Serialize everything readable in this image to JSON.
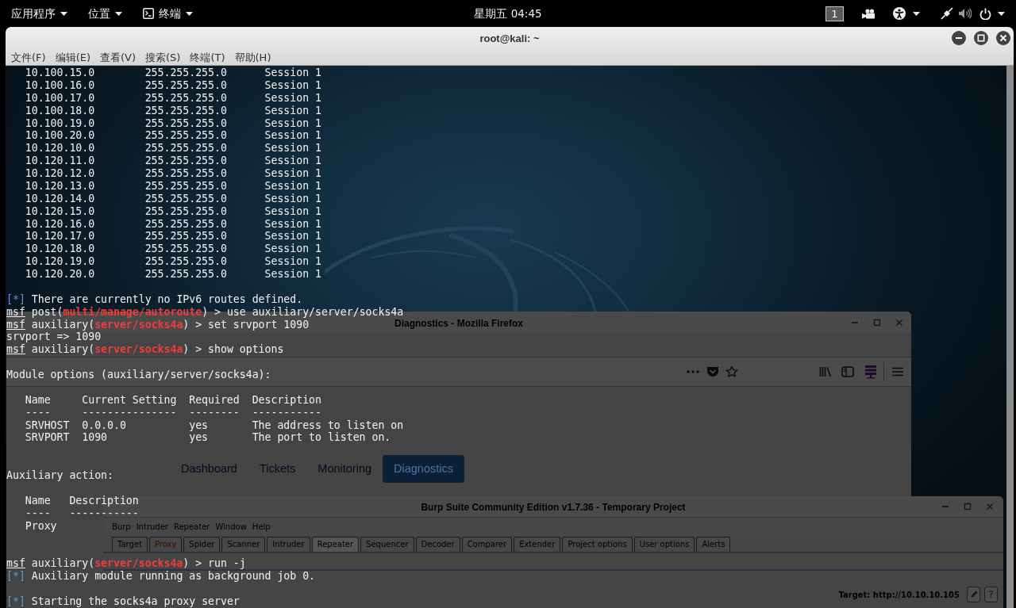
{
  "top_panel": {
    "menus": [
      {
        "label": "应用程序",
        "kind": "menu"
      },
      {
        "label": "位置",
        "kind": "menu"
      },
      {
        "label": "终端",
        "kind": "terminal"
      }
    ],
    "clock": "星期五 04:45",
    "workspace": "1"
  },
  "terminal": {
    "title": "root@kali: ~",
    "menu": [
      "文件(F)",
      "编辑(E)",
      "查看(V)",
      "搜索(S)",
      "终端(T)",
      "帮助(H)"
    ],
    "blocks": [
      {
        "kind": "route_table",
        "rows": [
          {
            "subnet": "10.100.15.0",
            "netmask": "255.255.255.0",
            "gateway": "Session 1"
          },
          {
            "subnet": "10.100.16.0",
            "netmask": "255.255.255.0",
            "gateway": "Session 1"
          },
          {
            "subnet": "10.100.17.0",
            "netmask": "255.255.255.0",
            "gateway": "Session 1"
          },
          {
            "subnet": "10.100.18.0",
            "netmask": "255.255.255.0",
            "gateway": "Session 1"
          },
          {
            "subnet": "10.100.19.0",
            "netmask": "255.255.255.0",
            "gateway": "Session 1"
          },
          {
            "subnet": "10.100.20.0",
            "netmask": "255.255.255.0",
            "gateway": "Session 1"
          },
          {
            "subnet": "10.120.10.0",
            "netmask": "255.255.255.0",
            "gateway": "Session 1"
          },
          {
            "subnet": "10.120.11.0",
            "netmask": "255.255.255.0",
            "gateway": "Session 1"
          },
          {
            "subnet": "10.120.12.0",
            "netmask": "255.255.255.0",
            "gateway": "Session 1"
          },
          {
            "subnet": "10.120.13.0",
            "netmask": "255.255.255.0",
            "gateway": "Session 1"
          },
          {
            "subnet": "10.120.14.0",
            "netmask": "255.255.255.0",
            "gateway": "Session 1"
          },
          {
            "subnet": "10.120.15.0",
            "netmask": "255.255.255.0",
            "gateway": "Session 1"
          },
          {
            "subnet": "10.120.16.0",
            "netmask": "255.255.255.0",
            "gateway": "Session 1"
          },
          {
            "subnet": "10.120.17.0",
            "netmask": "255.255.255.0",
            "gateway": "Session 1"
          },
          {
            "subnet": "10.120.18.0",
            "netmask": "255.255.255.0",
            "gateway": "Session 1"
          },
          {
            "subnet": "10.120.19.0",
            "netmask": "255.255.255.0",
            "gateway": "Session 1"
          },
          {
            "subnet": "10.120.20.0",
            "netmask": "255.255.255.0",
            "gateway": "Session 1"
          }
        ]
      },
      {
        "kind": "blank"
      },
      {
        "kind": "status",
        "segments": [
          "[*]",
          " There are currently no IPv6 routes defined."
        ]
      },
      {
        "kind": "command",
        "segments": [
          "msf",
          " post(",
          "multi/manage/autoroute",
          ") > use auxiliary/server/socks4a"
        ]
      },
      {
        "kind": "command",
        "segments": [
          "msf",
          " auxiliary(",
          "server/socks4a",
          ") > set srvport 1090"
        ]
      },
      {
        "kind": "output",
        "text": "srvport => 1090"
      },
      {
        "kind": "command",
        "segments": [
          "msf",
          " auxiliary(",
          "server/socks4a",
          ") > show options"
        ]
      },
      {
        "kind": "blank"
      },
      {
        "kind": "output",
        "text": "Module options (auxiliary/server/socks4a):"
      },
      {
        "kind": "blank"
      },
      {
        "kind": "table",
        "columns": [
          {
            "heading": "Name",
            "rule": "----"
          },
          {
            "heading": "Current Setting",
            "rule": "---------------"
          },
          {
            "heading": "Required",
            "rule": "--------"
          },
          {
            "heading": "Description",
            "rule": "-----------"
          }
        ],
        "rows": [
          [
            "SRVHOST",
            "0.0.0.0",
            "yes",
            "The address to listen on"
          ],
          [
            "SRVPORT",
            "1090",
            "yes",
            "The port to listen on."
          ]
        ]
      },
      {
        "kind": "blank"
      },
      {
        "kind": "blank"
      },
      {
        "kind": "output",
        "text": "Auxiliary action:"
      },
      {
        "kind": "blank"
      },
      {
        "kind": "table",
        "columns": [
          {
            "heading": "Name",
            "rule": "----"
          },
          {
            "heading": "Description",
            "rule": "-----------"
          }
        ],
        "rows": [
          [
            "Proxy"
          ]
        ]
      },
      {
        "kind": "blank"
      },
      {
        "kind": "blank"
      },
      {
        "kind": "command",
        "segments": [
          "msf",
          " auxiliary(",
          "server/socks4a",
          ") > run -j"
        ]
      },
      {
        "kind": "status",
        "segments": [
          "[*]",
          " Auxiliary module running as background job 0."
        ]
      },
      {
        "kind": "blank"
      },
      {
        "kind": "status",
        "segments": [
          "[*]",
          " Starting the socks4a proxy server"
        ]
      }
    ]
  },
  "browser_window": {
    "title": "Diagnostics - Mozilla Firefox",
    "nav_links": [
      {
        "label": "Dashboard",
        "selected": false
      },
      {
        "label": "Tickets",
        "selected": false
      },
      {
        "label": "Monitoring",
        "selected": false
      },
      {
        "label": "Diagnostics",
        "selected": true
      }
    ]
  },
  "burp_window": {
    "title": "Burp Suite Community Edition v1.7.36 - Temporary Project",
    "menu": [
      "Burp",
      "Intruder",
      "Repeater",
      "Window",
      "Help"
    ],
    "tabs": [
      {
        "label": "Target",
        "selected": false,
        "highlighted": false
      },
      {
        "label": "Proxy",
        "selected": false,
        "highlighted": true
      },
      {
        "label": "Spider",
        "selected": false,
        "highlighted": false
      },
      {
        "label": "Scanner",
        "selected": false,
        "highlighted": false
      },
      {
        "label": "Intruder",
        "selected": false,
        "highlighted": false
      },
      {
        "label": "Repeater",
        "selected": true,
        "highlighted": false
      },
      {
        "label": "Sequencer",
        "selected": false,
        "highlighted": false
      },
      {
        "label": "Decoder",
        "selected": false,
        "highlighted": false
      },
      {
        "label": "Comparer",
        "selected": false,
        "highlighted": false
      },
      {
        "label": "Extender",
        "selected": false,
        "highlighted": false
      },
      {
        "label": "Project options",
        "selected": false,
        "highlighted": false
      },
      {
        "label": "User options",
        "selected": false,
        "highlighted": false
      },
      {
        "label": "Alerts",
        "selected": false,
        "highlighted": false
      }
    ],
    "target": "Target: http://10.10.10.105",
    "help_button": "?"
  }
}
